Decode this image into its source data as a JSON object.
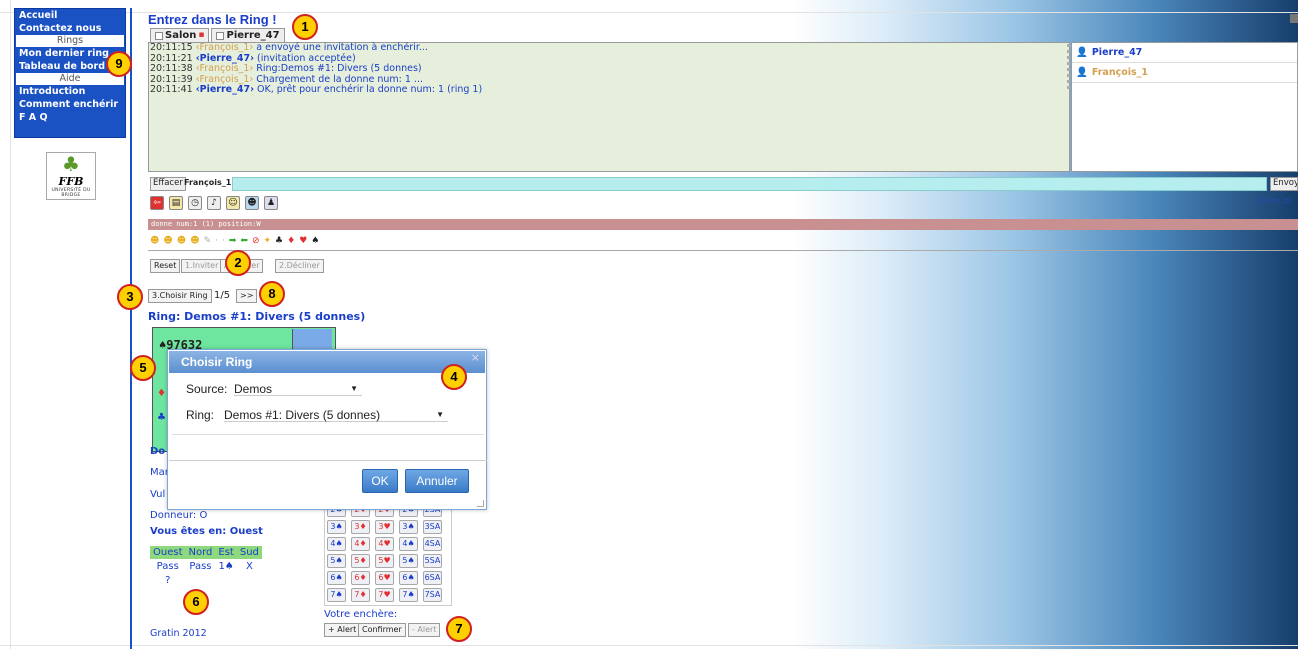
{
  "sidebar": {
    "items": [
      "Accueil",
      "Contactez nous"
    ],
    "section_rings": "Rings",
    "rings_items": [
      "Mon dernier ring",
      "Tableau de bord"
    ],
    "section_aide": "Aide",
    "aide_items": [
      "Introduction",
      "Comment enchérir",
      "F A Q"
    ],
    "logo_text": "FFB",
    "logo_sub": "UNIVERSITÉ DU BRIDGE"
  },
  "header": {
    "title": "Entrez dans le Ring !",
    "tabs": [
      "Salon",
      "Pierre_47"
    ]
  },
  "chat": {
    "lines": [
      {
        "time": "20:11:15",
        "from": "‹François_1›",
        "msg": " a envoyé une invitation à enchérir..."
      },
      {
        "time": "20:11:21",
        "from": "‹Pierre_47›",
        "msg": " (invitation acceptée)"
      },
      {
        "time": "20:11:38",
        "from": "‹François_1›",
        "msg": " Ring:Demos #1: Divers (5 donnes)"
      },
      {
        "time": "20:11:39",
        "from": "‹François_1›",
        "msg": " Chargement de la donne num: 1 ..."
      },
      {
        "time": "20:11:41",
        "from": "‹Pierre_47›",
        "msg": " OK, prêt pour enchérir la donne num: 1 (ring 1)"
      }
    ],
    "users": [
      "Pierre_47",
      "François_1"
    ]
  },
  "input": {
    "clear_label": "Effacer",
    "user_label": "François_1",
    "send_label": "Envoyer",
    "status_text": "162ms 20"
  },
  "deal_bar": "donne num:1 (1) position:W",
  "controls": {
    "reset": "Reset",
    "invite": "1.Inviter",
    "accept": "Accepter",
    "decline": "2.Décliner",
    "choose_ring": "3.Choisir Ring",
    "page": "1/5",
    "next": ">>"
  },
  "ring_label": "Ring: Demos #1: Divers (5 donnes)",
  "hand": {
    "spades": "♠97632",
    "diamonds": "♦",
    "clubs": "♣"
  },
  "info": {
    "donne": "Do",
    "marque": "Mar",
    "vul": "Vul",
    "donneur": "Donneur: O",
    "position": "Vous êtes en: Ouest",
    "footer": "Gratin 2012"
  },
  "auction": {
    "headers": [
      "Ouest",
      "Nord",
      "Est",
      "Sud"
    ],
    "row1": [
      "Pass",
      "Pass",
      "1♠",
      "X"
    ],
    "row2": [
      "?",
      "",
      "",
      ""
    ]
  },
  "bidding": {
    "levels": [
      [
        "2♠",
        "2♦",
        "2♥",
        "2♠",
        "2SA"
      ],
      [
        "3♠",
        "3♦",
        "3♥",
        "3♠",
        "3SA"
      ],
      [
        "4♠",
        "4♦",
        "4♥",
        "4♠",
        "4SA"
      ],
      [
        "5♠",
        "5♦",
        "5♥",
        "5♠",
        "5SA"
      ],
      [
        "6♠",
        "6♦",
        "6♥",
        "6♠",
        "6SA"
      ],
      [
        "7♠",
        "7♦",
        "7♥",
        "7♠",
        "7SA"
      ]
    ],
    "prompt": "Votre enchère:",
    "alert_plus": "+ Alert",
    "confirm": "Confirmer",
    "alert_minus": "- Alert"
  },
  "dialog": {
    "title": "Choisir Ring",
    "source_label": "Source:",
    "source_value": "Demos",
    "ring_label": "Ring:",
    "ring_value": "Demos #1: Divers (5 donnes)",
    "ok": "OK",
    "cancel": "Annuler"
  },
  "callouts": [
    "1",
    "2",
    "3",
    "4",
    "5",
    "6",
    "7",
    "8",
    "9"
  ]
}
